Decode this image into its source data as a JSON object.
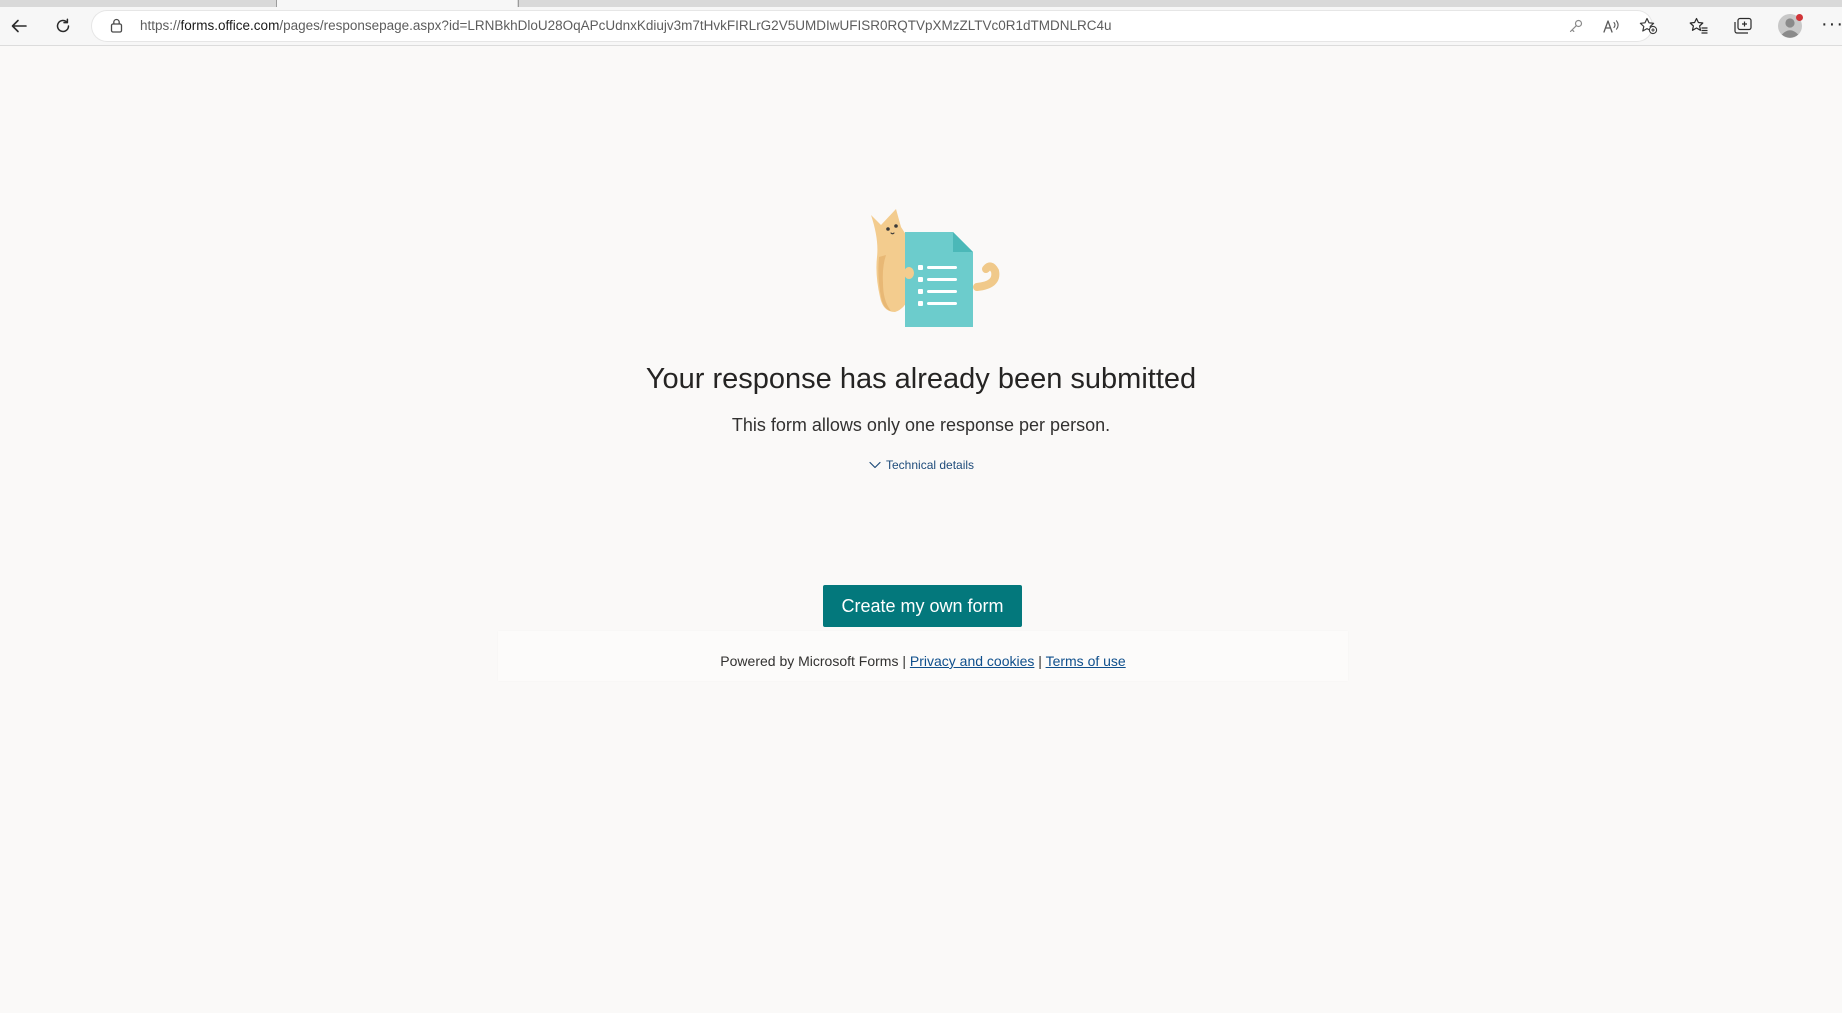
{
  "browser": {
    "url_prefix": "https://",
    "url_domain": "forms.office.com",
    "url_path": "/pages/responsepage.aspx?id=LRNBkhDloU28OqAPcUdnxKdiujv3m7tHvkFIRLrG2V5UMDIwUFISR0RQTVpXMzZLTVc0R1dTMDNLRC4u",
    "icons": [
      "back-icon",
      "refresh-icon",
      "lock-icon",
      "key-icon",
      "read-aloud-icon",
      "add-favorite-icon",
      "favorites-icon",
      "collections-icon",
      "profile-icon",
      "more-icon"
    ],
    "more_label": "···"
  },
  "page": {
    "headline": "Your response has already been submitted",
    "subline": "This form allows only one response per person.",
    "technical_details": "Technical details",
    "cta_label": "Create my own form",
    "accent_color": "#03787c"
  },
  "footer": {
    "powered_by": "Powered by Microsoft Forms | ",
    "privacy_link": "Privacy and cookies",
    "separator": " | ",
    "terms_link": "Terms of use"
  }
}
